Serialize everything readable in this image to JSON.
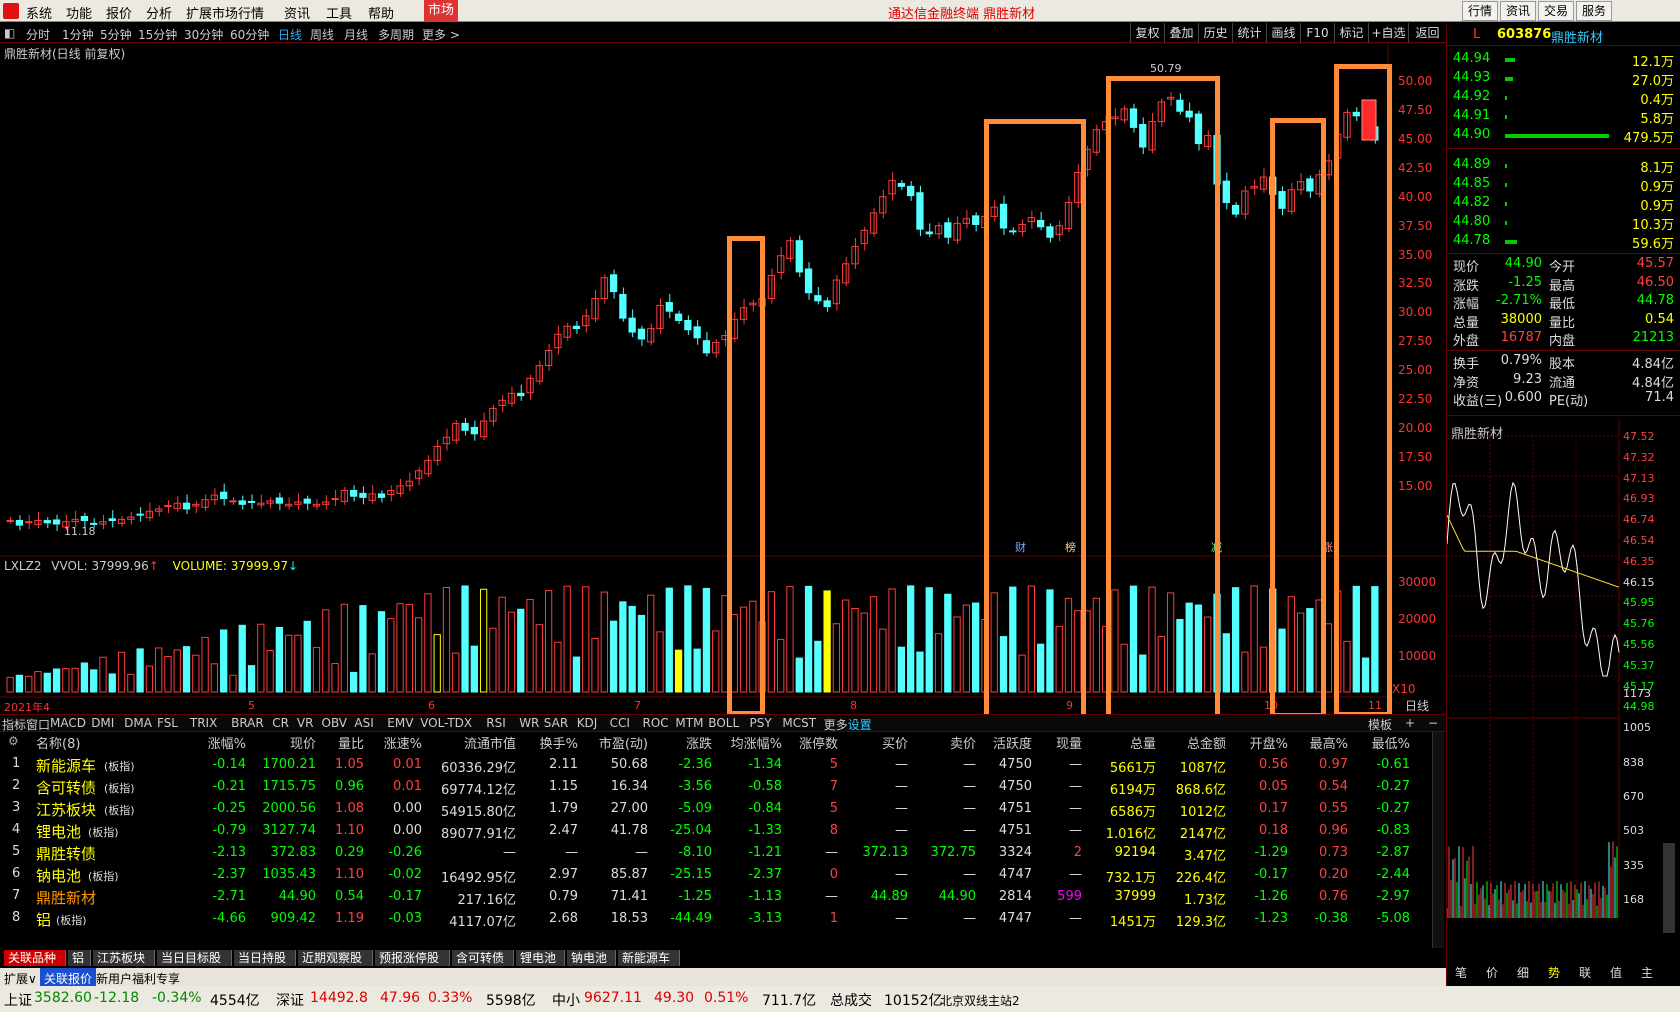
{
  "menu": {
    "items": [
      "系统",
      "功能",
      "报价",
      "分析",
      "扩展市场行情",
      "资讯",
      "工具",
      "帮助"
    ],
    "market": "市场",
    "title": "通达信金融终端  鼎胜新材",
    "right": [
      "行情",
      "资讯",
      "交易",
      "服务"
    ]
  },
  "periods": [
    "分时",
    "1分钟",
    "5分钟",
    "15分钟",
    "30分钟",
    "60分钟",
    "日线",
    "周线",
    "月线",
    "多周期",
    "更多 >"
  ],
  "tools": [
    "复权",
    "叠加",
    "历史",
    "统计",
    "画线",
    "F10",
    "标记",
    "+自选",
    "返回"
  ],
  "chart_title": "鼎胜新材(日线 前复权)",
  "price_axis": [
    "50.00",
    "47.50",
    "45.00",
    "42.50",
    "40.00",
    "37.50",
    "35.00",
    "32.50",
    "30.00",
    "27.50",
    "25.00",
    "22.50",
    "20.00",
    "17.50",
    "15.00"
  ],
  "max_label": "50.79",
  "min_label": "11.18",
  "markers": [
    {
      "t": "财"
    },
    {
      "t": "榜"
    },
    {
      "t": "减"
    },
    {
      "t": "涨"
    }
  ],
  "vol_header": {
    "a": "LXLZ2",
    "b": "VVOL: 37999.96",
    "c": "VOLUME: 37999.97"
  },
  "vol_axis": [
    "30000",
    "20000",
    "10000",
    "X10"
  ],
  "months": [
    "2021年4",
    "5",
    "6",
    "7",
    "8",
    "9",
    "10",
    "11"
  ],
  "ind_buttons": [
    "指标",
    "窗口",
    "MACD",
    "DMI",
    "DMA",
    "FSL",
    "TRIX",
    "BRAR",
    "CR",
    "VR",
    "OBV",
    "ASI",
    "EMV",
    "VOL-TDX",
    "RSI",
    "WR",
    "SAR",
    "KDJ",
    "CCI",
    "ROC",
    "MTM",
    "BOLL",
    "PSY",
    "MCST",
    "更多",
    "设置"
  ],
  "ind_right": [
    "模板",
    "+"
  ],
  "table": {
    "headers": [
      "名称(8)",
      "涨幅%",
      "现价",
      "量比",
      "涨速%",
      "流通市值",
      "换手%",
      "市盈(动)",
      "涨跌",
      "均涨幅%",
      "涨停数",
      "买价",
      "卖价",
      "活跃度",
      "现量",
      "总量",
      "总金额",
      "开盘%",
      "最高%",
      "最低%"
    ],
    "rows": [
      [
        "1",
        "新能源车",
        "(板指)",
        "-0.14",
        "1700.21",
        "1.05",
        "0.01",
        "60336.29亿",
        "2.11",
        "50.68",
        "-2.36",
        "-1.34",
        "5",
        "—",
        "—",
        "4750",
        "—",
        "5661万",
        "1087亿",
        "0.56",
        "0.97",
        "-0.61"
      ],
      [
        "2",
        "含可转债",
        "(板指)",
        "-0.21",
        "1715.75",
        "0.96",
        "0.01",
        "69774.12亿",
        "1.15",
        "16.34",
        "-3.56",
        "-0.58",
        "7",
        "—",
        "—",
        "4750",
        "—",
        "6194万",
        "868.6亿",
        "0.05",
        "0.54",
        "-0.27"
      ],
      [
        "3",
        "江苏板块",
        "(板指)",
        "-0.25",
        "2000.56",
        "1.08",
        "0.00",
        "54915.80亿",
        "1.79",
        "27.00",
        "-5.09",
        "-0.84",
        "5",
        "—",
        "—",
        "4751",
        "—",
        "6586万",
        "1012亿",
        "0.17",
        "0.55",
        "-0.27"
      ],
      [
        "4",
        "锂电池",
        "(板指)",
        "-0.79",
        "3127.74",
        "1.10",
        "0.00",
        "89077.91亿",
        "2.47",
        "41.78",
        "-25.04",
        "-1.33",
        "8",
        "—",
        "—",
        "4751",
        "—",
        "1.016亿",
        "2147亿",
        "0.18",
        "0.96",
        "-0.83"
      ],
      [
        "5",
        "鼎胜转债",
        "",
        "-2.13",
        "372.83",
        "0.29",
        "-0.26",
        "—",
        "—",
        "—",
        "-8.10",
        "-1.21",
        "—",
        "372.13",
        "372.75",
        "3324",
        "2",
        "92194",
        "3.47亿",
        "-1.29",
        "0.73",
        "-2.87"
      ],
      [
        "6",
        "钠电池",
        "(板指)",
        "-2.37",
        "1035.43",
        "1.10",
        "-0.02",
        "16492.95亿",
        "2.97",
        "85.87",
        "-25.15",
        "-2.37",
        "0",
        "—",
        "—",
        "4747",
        "—",
        "732.1万",
        "226.4亿",
        "-0.17",
        "0.20",
        "-2.44"
      ],
      [
        "7",
        "鼎胜新材",
        "",
        "-2.71",
        "44.90",
        "0.54",
        "-0.17",
        "217.16亿",
        "0.79",
        "71.41",
        "-1.25",
        "-1.13",
        "—",
        "44.89",
        "44.90",
        "2814",
        "599",
        "37999",
        "1.73亿",
        "-1.26",
        "0.76",
        "-2.97"
      ],
      [
        "8",
        "铝",
        "(板指)",
        "-4.66",
        "909.42",
        "1.19",
        "-0.03",
        "4117.07亿",
        "2.68",
        "18.53",
        "-44.49",
        "-3.13",
        "1",
        "—",
        "—",
        "4747",
        "—",
        "1451万",
        "129.3亿",
        "-1.23",
        "-0.38",
        "-5.08"
      ]
    ]
  },
  "bottom_tabs": [
    "关联品种",
    "铝",
    "江苏板块",
    "当日目标股",
    "当日持股",
    "近期观察股",
    "预报涨停股",
    "含可转债",
    "锂电池",
    "钠电池",
    "新能源车"
  ],
  "subbar": [
    "扩展∨",
    "关联报价",
    "新用户福利专享"
  ],
  "status": {
    "sh_label": "上证",
    "sh_val": "3582.60",
    "sh_chg": "-12.18",
    "sh_pct": "-0.34%",
    "sh_amt": "4554亿",
    "sz_label": "深证",
    "sz_val": "14492.8",
    "sz_chg": "47.96",
    "sz_pct": "0.33%",
    "sz_amt": "5598亿",
    "zx_label": "中小",
    "zx_val": "9627.11",
    "zx_chg": "49.30",
    "zx_pct": "0.51%",
    "zx_amt": "711.7亿",
    "total_label": "总成交",
    "total_amt": "10152亿",
    "server": "北京双线主站2"
  },
  "right": {
    "code": "603876",
    "name": "鼎胜新材",
    "flag": "L",
    "asks": [
      [
        "44.94",
        "12.1万"
      ],
      [
        "44.93",
        "27.0万"
      ],
      [
        "44.92",
        "0.4万"
      ],
      [
        "44.91",
        "5.8万"
      ],
      [
        "44.90",
        "479.5万"
      ]
    ],
    "bids": [
      [
        "44.89",
        "8.1万"
      ],
      [
        "44.85",
        "0.9万"
      ],
      [
        "44.82",
        "0.9万"
      ],
      [
        "44.80",
        "10.3万"
      ],
      [
        "44.78",
        "59.6万"
      ]
    ],
    "quote": [
      [
        "现价",
        "44.90",
        "今开",
        "45.57"
      ],
      [
        "涨跌",
        "-1.25",
        "最高",
        "46.50"
      ],
      [
        "涨幅",
        "-2.71%",
        "最低",
        "44.78"
      ],
      [
        "总量",
        "38000",
        "量比",
        "0.54"
      ],
      [
        "外盘",
        "16787",
        "内盘",
        "21213"
      ]
    ],
    "fin": [
      [
        "换手",
        "0.79%",
        "股本",
        "4.84亿"
      ],
      [
        "净资",
        "9.23",
        "流通",
        "4.84亿"
      ],
      [
        "收益(三)",
        "0.600",
        "PE(动)",
        "71.4"
      ]
    ],
    "mini_title": "鼎胜新材",
    "mini_axis": [
      "47.52",
      "47.32",
      "47.13",
      "46.93",
      "46.74",
      "46.54",
      "46.35",
      "46.15",
      "45.95",
      "45.76",
      "45.56",
      "45.37",
      "45.17",
      "44.98",
      "1173",
      "1005",
      "838",
      "670",
      "503",
      "335",
      "168"
    ],
    "tabs": [
      "笔",
      "价",
      "细",
      "势",
      "联",
      "值",
      "主"
    ]
  },
  "chart_data": {
    "type": "candlestick",
    "title": "鼎胜新材(日线 前复权)",
    "price_range": [
      11.18,
      50.79
    ],
    "candles_close": [
      12.0,
      11.6,
      11.9,
      12.0,
      11.8,
      11.7,
      11.9,
      12.1,
      12.0,
      11.7,
      11.9,
      12.0,
      12.1,
      12.3,
      12.5,
      12.8,
      13.0,
      13.3,
      13.5,
      13.0,
      13.4,
      13.8,
      14.2,
      13.9,
      13.7,
      13.4,
      13.6,
      13.5,
      13.7,
      13.5,
      13.4,
      13.6,
      13.5,
      13.4,
      13.6,
      13.9,
      14.6,
      14.1,
      14.0,
      14.3,
      14.0,
      14.6,
      15.0,
      15.4,
      16.3,
      17.2,
      18.4,
      19.2,
      20.4,
      19.8,
      19.5,
      20.6,
      21.7,
      22.4,
      23.0,
      22.8,
      24.3,
      25.4,
      26.7,
      28.1,
      28.8,
      28.6,
      29.7,
      31.2,
      33.0,
      31.8,
      29.5,
      28.3,
      27.7,
      28.6,
      30.6,
      30.1,
      29.3,
      28.5,
      27.8,
      26.5,
      27.4,
      28.0,
      29.4,
      30.4,
      30.8,
      31.2,
      33.2,
      34.9,
      36.2,
      33.5,
      31.7,
      31.0,
      30.5,
      32.8,
      34.2,
      35.7,
      37.1,
      38.6,
      40.0,
      41.4,
      40.9,
      40.1,
      37.2,
      36.8,
      37.5,
      36.5,
      37.7,
      38.1,
      37.6,
      38.3,
      39.1,
      37.3,
      37.0,
      37.6,
      38.2,
      37.4,
      36.5,
      37.5,
      39.5,
      42.1,
      44.1,
      45.8,
      46.5,
      46.9,
      47.6,
      46.0,
      44.3,
      46.5,
      48.2,
      48.6,
      47.4,
      46.9,
      44.6,
      45.3,
      41.1,
      39.5,
      38.5,
      40.5,
      40.9,
      41.7,
      40.2,
      39.0,
      40.6,
      41.3,
      40.5,
      41.9,
      43.1,
      45.4,
      47.3,
      47.0,
      46.3,
      44.9
    ],
    "volume_color_note": "red=up cyan=down yellow=vol spike green/magenta=highlighted"
  }
}
